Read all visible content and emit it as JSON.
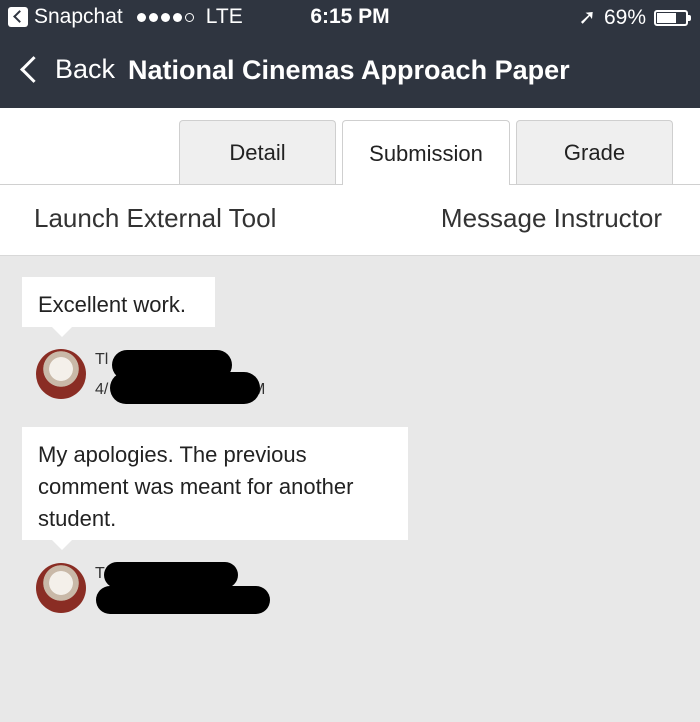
{
  "status_bar": {
    "carrier": "Snapchat",
    "network": "LTE",
    "time": "6:15 PM",
    "battery": "69%",
    "battery_level": 0.69
  },
  "nav": {
    "back_label": "Back",
    "title": "National Cinemas Approach Paper"
  },
  "tabs": [
    {
      "label": "Detail",
      "active": false
    },
    {
      "label": "Submission",
      "active": true
    },
    {
      "label": "Grade",
      "active": false
    }
  ],
  "actions": {
    "launch_tool": "Launch External Tool",
    "message_instructor": "Message Instructor"
  },
  "comments": [
    {
      "text": "Excellent work.",
      "author_fragment": "Tl",
      "date_fragment_start": "4/",
      "date_fragment_end": "M"
    },
    {
      "text": "My apologies. The previous comment was meant for another student.",
      "author_fragment": "T"
    }
  ],
  "colors": {
    "header_bg": "#2f3540",
    "content_bg": "#e8e8e8"
  }
}
